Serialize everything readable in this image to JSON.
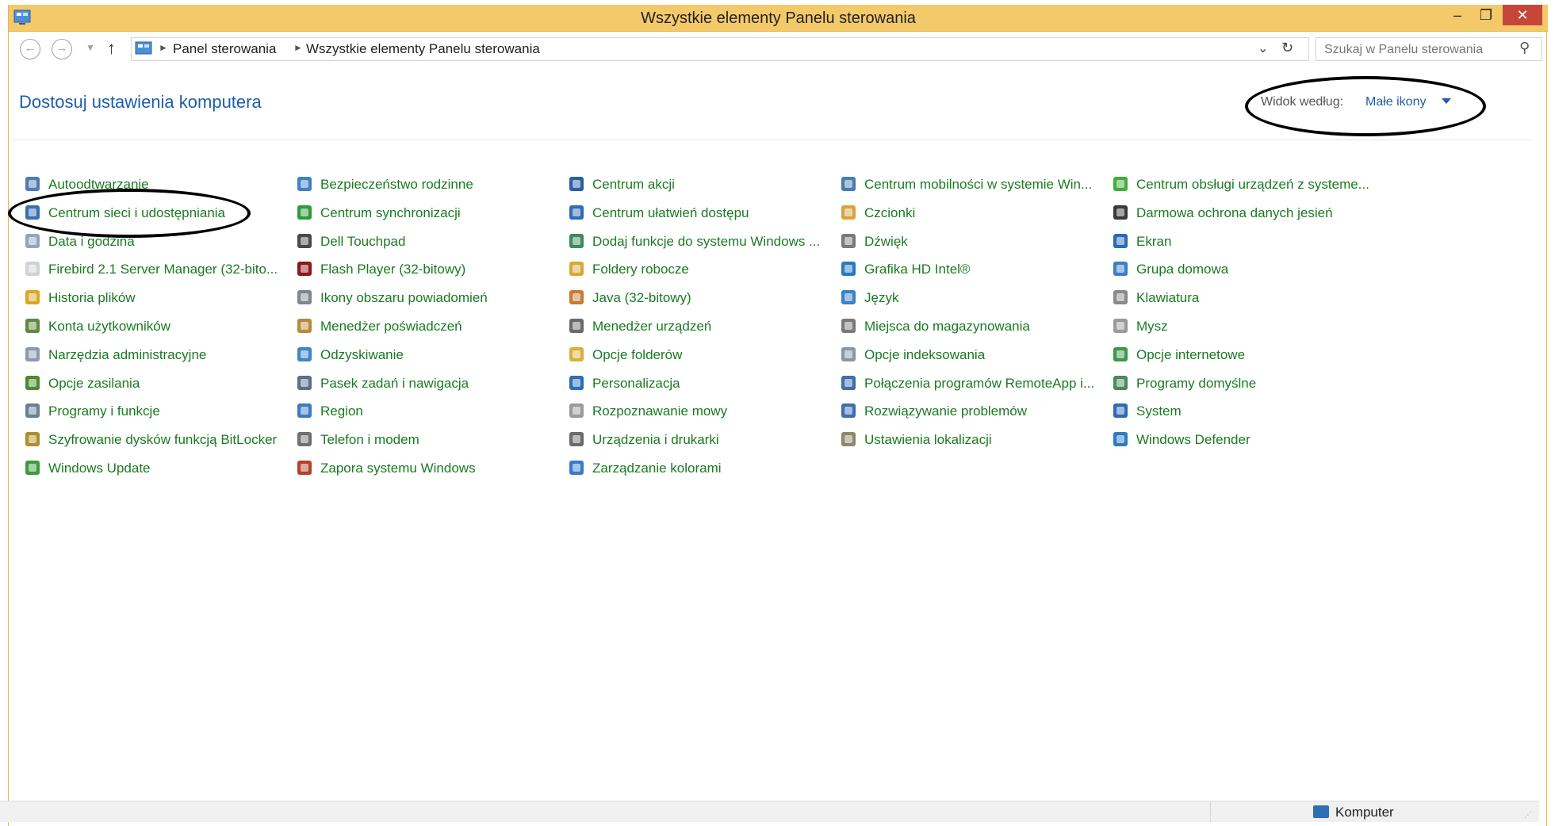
{
  "window": {
    "title": "Wszystkie elementy Panelu sterowania",
    "minimize": "–",
    "maximize": "❐",
    "close": "✕"
  },
  "address": {
    "back": "←",
    "forward": "→",
    "recent": "▼",
    "up": "↑",
    "crumbs": [
      "Panel sterowania",
      "Wszystkie elementy Panelu sterowania"
    ],
    "separator": "►",
    "dropdown": "⌄",
    "refresh": "↻",
    "search_placeholder": "Szukaj w Panelu sterowania",
    "search_icon": "⚲"
  },
  "header": {
    "title": "Dostosuj ustawienia komputera",
    "view_by_label": "Widok według:",
    "view_by_value": "Małe ikony"
  },
  "colors": {
    "link": "#1a7a22",
    "heading": "#1e5eab",
    "titlebar": "#f3c96a",
    "close": "#c7463a",
    "annotation": "#000000"
  },
  "columns": [
    {
      "items": [
        {
          "label": "Autoodtwarzanie",
          "icon": "autoplay-icon",
          "color": "#4f7db3"
        },
        {
          "label": "Centrum sieci i udostępniania",
          "icon": "network-icon",
          "color": "#3a6fb0"
        },
        {
          "label": "Data i godzina",
          "icon": "clock-icon",
          "color": "#8fa6c2"
        },
        {
          "label": "Firebird 2.1 Server Manager (32-bito...",
          "icon": "document-icon",
          "color": "#cfd3d8"
        },
        {
          "label": "Historia plików",
          "icon": "file-history-icon",
          "color": "#d9a727"
        },
        {
          "label": "Konta użytkowników",
          "icon": "users-icon",
          "color": "#5d8a3f"
        },
        {
          "label": "Narzędzia administracyjne",
          "icon": "admin-tools-icon",
          "color": "#8c9aae"
        },
        {
          "label": "Opcje zasilania",
          "icon": "power-icon",
          "color": "#4c8a2c"
        },
        {
          "label": "Programy i funkcje",
          "icon": "programs-icon",
          "color": "#6b7f96"
        },
        {
          "label": "Szyfrowanie dysków funkcją BitLocker",
          "icon": "bitlocker-icon",
          "color": "#b08c2a"
        },
        {
          "label": "Windows Update",
          "icon": "windows-update-icon",
          "color": "#3e9a3e"
        }
      ]
    },
    {
      "items": [
        {
          "label": "Bezpieczeństwo rodzinne",
          "icon": "family-safety-icon",
          "color": "#3f7fc5"
        },
        {
          "label": "Centrum synchronizacji",
          "icon": "sync-icon",
          "color": "#2f9a3a"
        },
        {
          "label": "Dell Touchpad",
          "icon": "touchpad-icon",
          "color": "#4a4a4a"
        },
        {
          "label": "Flash Player (32-bitowy)",
          "icon": "flash-icon",
          "color": "#8b1a14"
        },
        {
          "label": "Ikony obszaru powiadomień",
          "icon": "notification-area-icon",
          "color": "#7d8794"
        },
        {
          "label": "Menedżer poświadczeń",
          "icon": "credential-icon",
          "color": "#b9893a"
        },
        {
          "label": "Odzyskiwanie",
          "icon": "recovery-icon",
          "color": "#3d86c9"
        },
        {
          "label": "Pasek zadań i nawigacja",
          "icon": "taskbar-icon",
          "color": "#5a6f8a"
        },
        {
          "label": "Region",
          "icon": "globe-icon",
          "color": "#3a7cc0"
        },
        {
          "label": "Telefon i modem",
          "icon": "phone-icon",
          "color": "#6f6f6f"
        },
        {
          "label": "Zapora systemu Windows",
          "icon": "firewall-icon",
          "color": "#b5412d"
        }
      ]
    },
    {
      "items": [
        {
          "label": "Centrum akcji",
          "icon": "flag-icon",
          "color": "#2a5ea6"
        },
        {
          "label": "Centrum ułatwień dostępu",
          "icon": "accessibility-icon",
          "color": "#2f6bb8"
        },
        {
          "label": "Dodaj funkcje do systemu Windows ...",
          "icon": "add-features-icon",
          "color": "#3c8b5a"
        },
        {
          "label": "Foldery robocze",
          "icon": "work-folders-icon",
          "color": "#d9a63a"
        },
        {
          "label": "Java (32-bitowy)",
          "icon": "java-icon",
          "color": "#c97a32"
        },
        {
          "label": "Menedżer urządzeń",
          "icon": "device-manager-icon",
          "color": "#6a6a6a"
        },
        {
          "label": "Opcje folderów",
          "icon": "folder-options-icon",
          "color": "#d9b13a"
        },
        {
          "label": "Personalizacja",
          "icon": "personalization-icon",
          "color": "#2a6fb8"
        },
        {
          "label": "Rozpoznawanie mowy",
          "icon": "microphone-icon",
          "color": "#9a9a9a"
        },
        {
          "label": "Urządzenia i drukarki",
          "icon": "printer-icon",
          "color": "#6a6a6a"
        },
        {
          "label": "Zarządzanie kolorami",
          "icon": "color-management-icon",
          "color": "#3a7bc8"
        }
      ]
    },
    {
      "items": [
        {
          "label": "Centrum mobilności w systemie Win...",
          "icon": "mobility-icon",
          "color": "#4a7bb0"
        },
        {
          "label": "Czcionki",
          "icon": "fonts-icon",
          "color": "#d8a43a"
        },
        {
          "label": "Dźwięk",
          "icon": "speaker-icon",
          "color": "#7a7a7a"
        },
        {
          "label": "Grafika HD Intel®",
          "icon": "intel-graphics-icon",
          "color": "#2a7ac0"
        },
        {
          "label": "Język",
          "icon": "language-icon",
          "color": "#3a82c9"
        },
        {
          "label": "Miejsca do magazynowania",
          "icon": "storage-icon",
          "color": "#7a7a7a"
        },
        {
          "label": "Opcje indeksowania",
          "icon": "indexing-icon",
          "color": "#8a96a6"
        },
        {
          "label": "Połączenia programów RemoteApp i...",
          "icon": "remoteapp-icon",
          "color": "#3f6fa8"
        },
        {
          "label": "Rozwiązywanie problemów",
          "icon": "troubleshooting-icon",
          "color": "#3a6fb0"
        },
        {
          "label": "Ustawienia lokalizacji",
          "icon": "location-icon",
          "color": "#8a8a6a"
        }
      ]
    },
    {
      "items": [
        {
          "label": "Centrum obsługi urządzeń z systeme...",
          "icon": "device-center-icon",
          "color": "#3fae3a"
        },
        {
          "label": "Darmowa ochrona danych jesień",
          "icon": "data-protection-icon",
          "color": "#3a3a3a"
        },
        {
          "label": "Ekran",
          "icon": "display-icon",
          "color": "#2a6ab8"
        },
        {
          "label": "Grupa domowa",
          "icon": "homegroup-icon",
          "color": "#3a7fc5"
        },
        {
          "label": "Klawiatura",
          "icon": "keyboard-icon",
          "color": "#8a8a8a"
        },
        {
          "label": "Mysz",
          "icon": "mouse-icon",
          "color": "#9a9a9a"
        },
        {
          "label": "Opcje internetowe",
          "icon": "internet-options-icon",
          "color": "#3a9a4a"
        },
        {
          "label": "Programy domyślne",
          "icon": "default-programs-icon",
          "color": "#4a8a5a"
        },
        {
          "label": "System",
          "icon": "system-icon",
          "color": "#2f6ab5"
        },
        {
          "label": "Windows Defender",
          "icon": "windows-defender-icon",
          "color": "#2f7ac5"
        }
      ]
    }
  ],
  "status": {
    "location": "Komputer",
    "grip": "⋰"
  }
}
